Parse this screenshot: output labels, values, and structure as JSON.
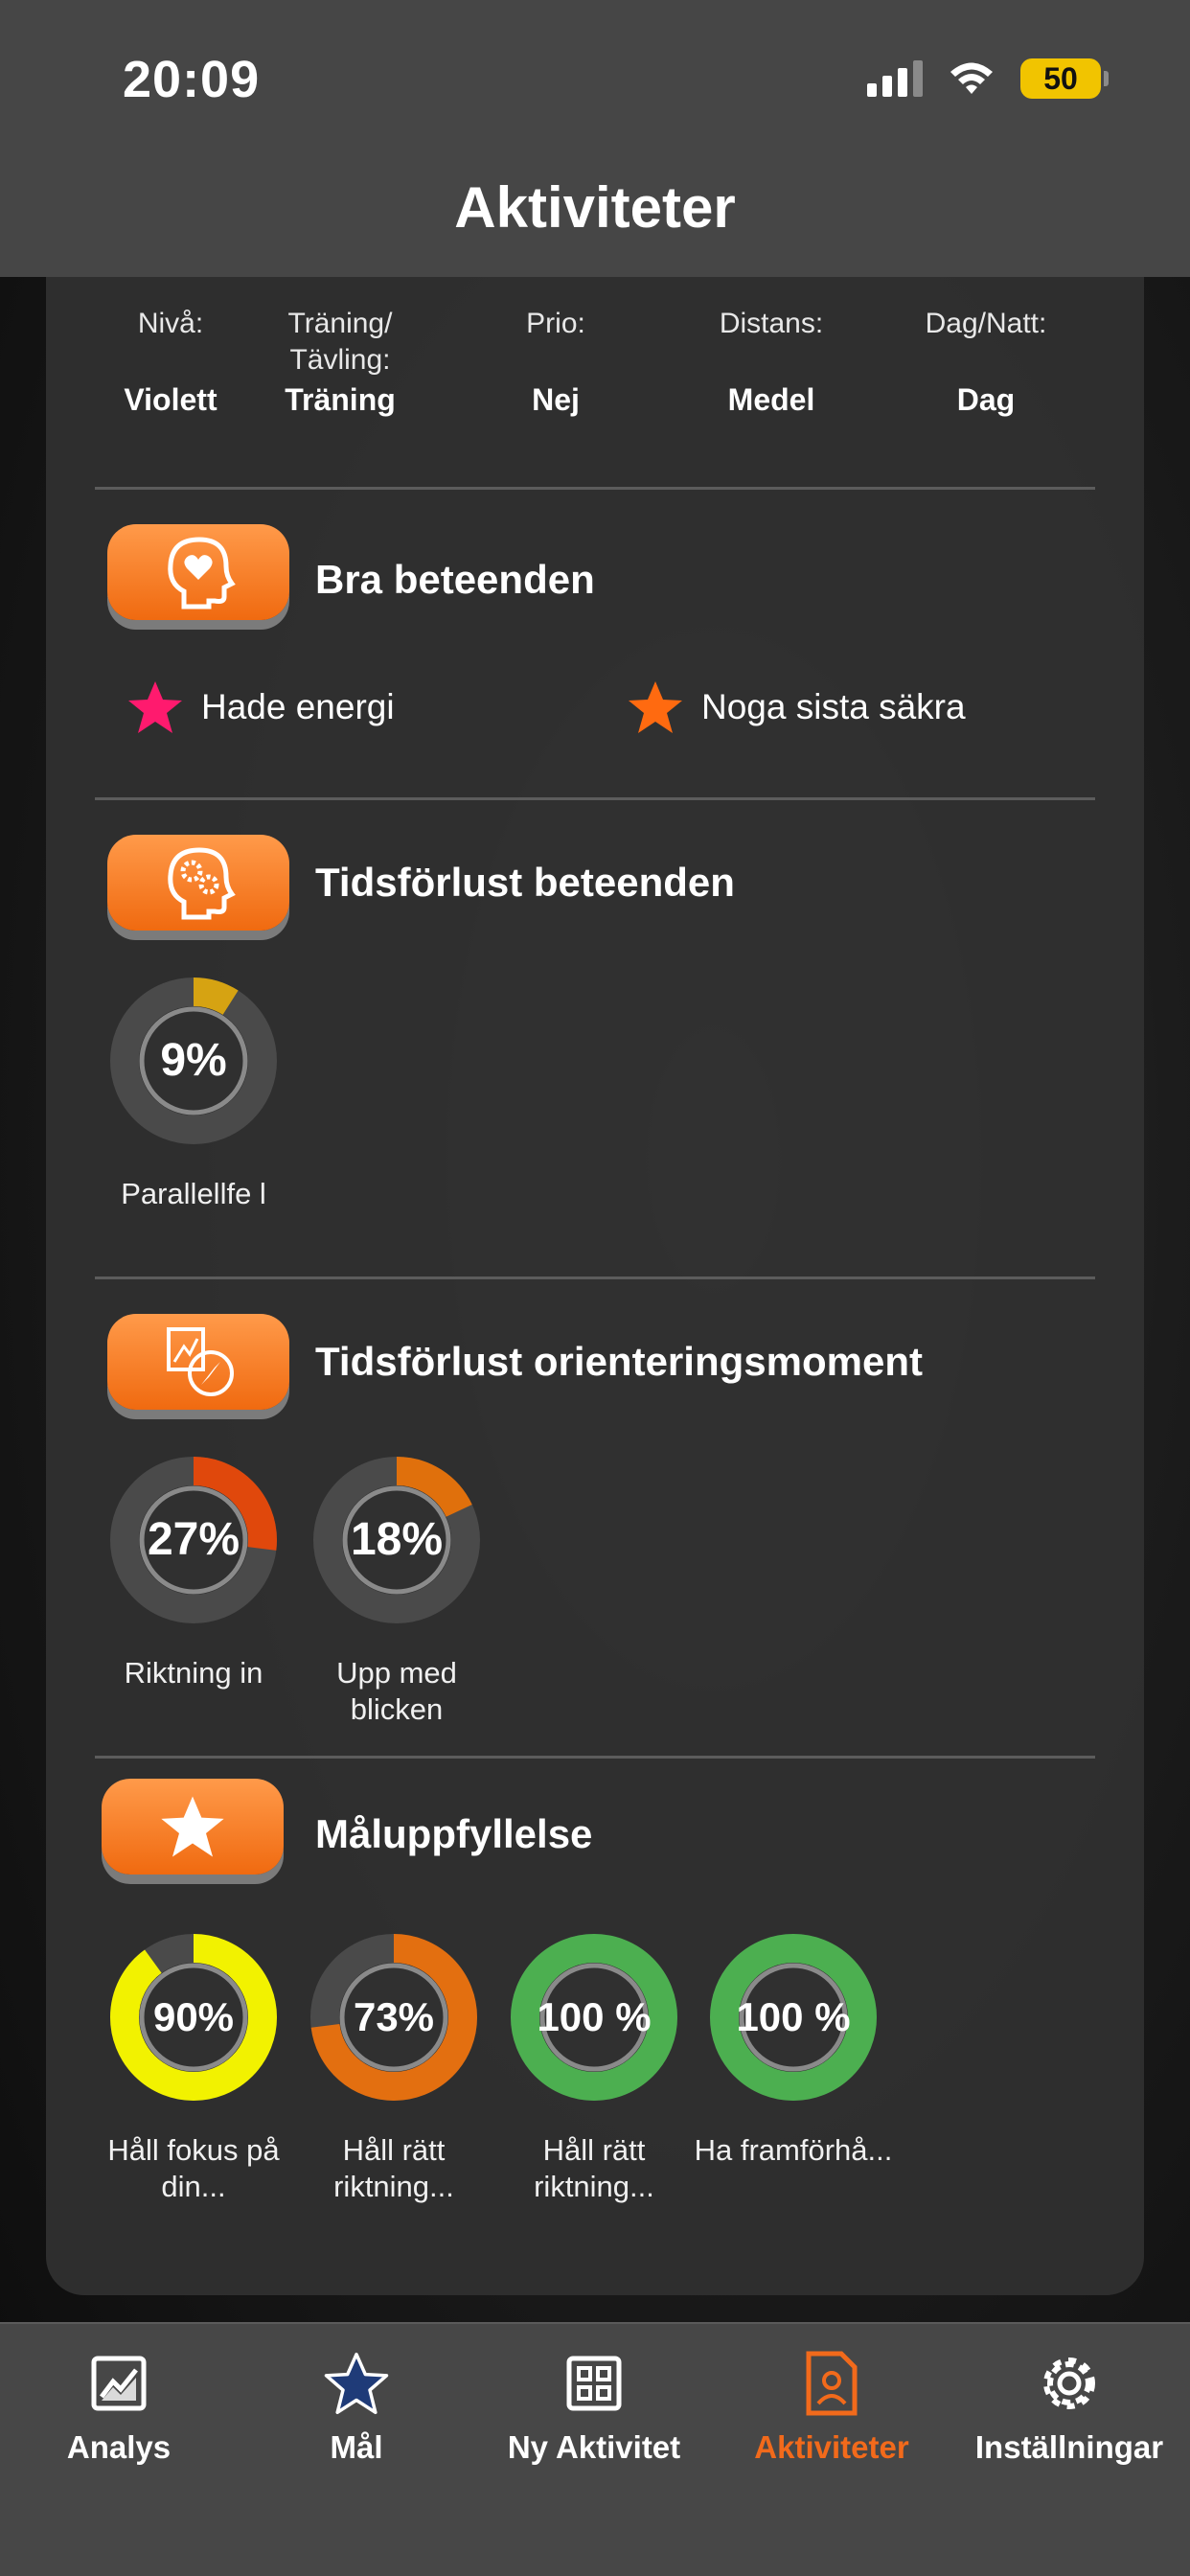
{
  "status": {
    "time": "20:09",
    "battery": "50"
  },
  "header": {
    "title": "Aktiviteter"
  },
  "info": [
    {
      "label": "Nivå:",
      "value": "Violett"
    },
    {
      "label": "Träning/ Tävling:",
      "value": "Träning"
    },
    {
      "label": "Prio:",
      "value": "Nej"
    },
    {
      "label": "Distans:",
      "value": "Medel"
    },
    {
      "label": "Dag/Natt:",
      "value": "Dag"
    }
  ],
  "sections": {
    "good": {
      "title": "Bra beteenden",
      "items": [
        {
          "label": "Hade energi",
          "star_color": "#ff1a6e"
        },
        {
          "label": "Noga sista säkra",
          "star_color": "#ff6a10"
        }
      ]
    },
    "timeloss_behavior": {
      "title": "Tidsförlust beteenden",
      "rings": [
        {
          "percent": 9,
          "text": "9%",
          "label": "Parallellfe l",
          "color": "#d6a312"
        }
      ]
    },
    "timeloss_orientation": {
      "title": "Tidsförlust orienteringsmoment",
      "rings": [
        {
          "percent": 27,
          "text": "27%",
          "label": "Riktning in",
          "color": "#e0480c"
        },
        {
          "percent": 18,
          "text": "18%",
          "label": "Upp med blicken",
          "color": "#e0700c"
        }
      ]
    },
    "goals": {
      "title": "Måluppfyllelse",
      "rings": [
        {
          "percent": 90,
          "text": "90%",
          "label": "Håll fokus på din...",
          "color": "#f2f200"
        },
        {
          "percent": 73,
          "text": "73%",
          "label": "Håll rätt riktning...",
          "color": "#e36f10"
        },
        {
          "percent": 100,
          "text": "100 %",
          "label": "Håll rätt riktning...",
          "color": "#4caf50"
        },
        {
          "percent": 100,
          "text": "100 %",
          "label": "Ha framförhå...",
          "color": "#4caf50"
        }
      ]
    }
  },
  "tabs": [
    {
      "label": "Analys",
      "icon": "chart-icon",
      "active": false
    },
    {
      "label": "Mål",
      "icon": "star-icon",
      "active": false
    },
    {
      "label": "Ny Aktivitet",
      "icon": "grid-icon",
      "active": false
    },
    {
      "label": "Aktiviteter",
      "icon": "document-person-icon",
      "active": true
    },
    {
      "label": "Inställningar",
      "icon": "gear-icon",
      "active": false
    }
  ],
  "colors": {
    "accent": "#f26a1b",
    "tab_active": "#f26a1b"
  }
}
